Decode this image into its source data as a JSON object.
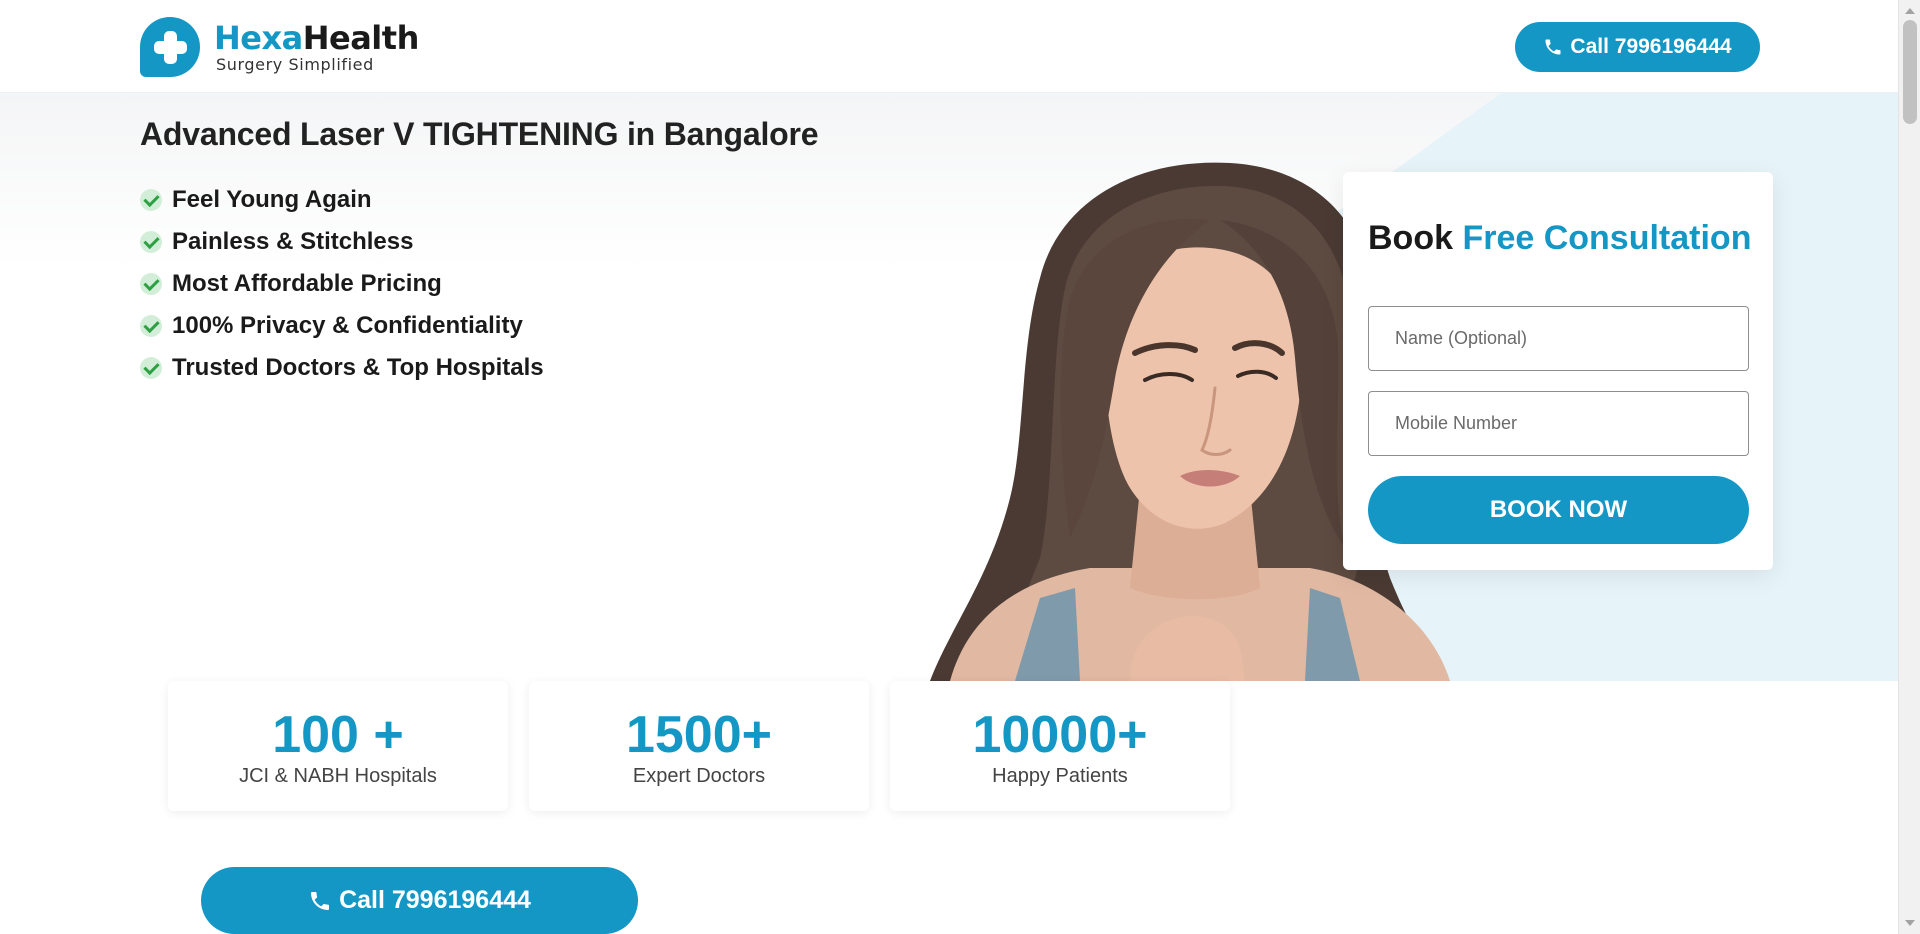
{
  "brand": {
    "name_part1": "Hexa",
    "name_part2": "Health",
    "tagline": "Surgery Simplified",
    "accent_color": "#1597c6"
  },
  "header": {
    "call_label": "Call 7996196444",
    "call_icon": "phone-icon"
  },
  "hero": {
    "title": "Advanced Laser V TIGHTENING in Bangalore",
    "features": [
      "Feel Young Again",
      "Painless & Stitchless",
      "Most Affordable Pricing",
      "100% Privacy & Confidentiality",
      "Trusted Doctors & Top Hospitals"
    ],
    "feature_icon": "check-icon"
  },
  "form": {
    "title_part1": "Book",
    "title_part2": "Free Consultation",
    "name_placeholder": "Name (Optional)",
    "mobile_placeholder": "Mobile Number",
    "submit_label": "BOOK NOW"
  },
  "stats": [
    {
      "value": "100 +",
      "label": "JCI & NABH Hospitals"
    },
    {
      "value": "1500+",
      "label": "Expert Doctors"
    },
    {
      "value": "10000+",
      "label": "Happy Patients"
    }
  ],
  "bottom_cta": {
    "call_label": "Call 7996196444"
  }
}
